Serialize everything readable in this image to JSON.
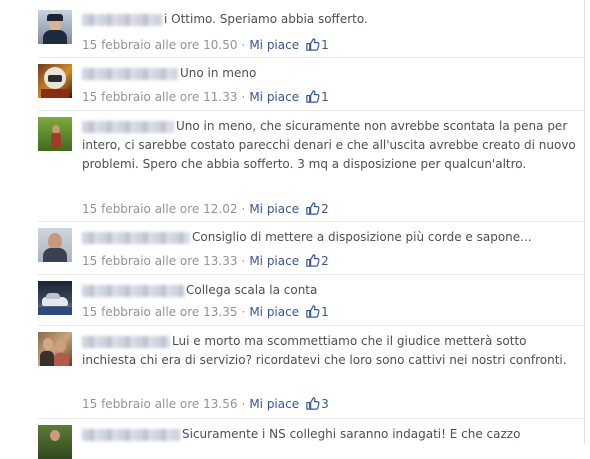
{
  "comments": [
    {
      "text": "i Ottimo. Speriamo abbia sofferto.",
      "time": "15 febbraio alle ore 10.50",
      "like_label": "Mi piace",
      "likes": "1",
      "avatar": "police-officer-avatar"
    },
    {
      "text": "Uno in meno",
      "time": "15 febbraio alle ore 11.33",
      "like_label": "Mi piace",
      "likes": "1",
      "avatar": "helmet-avatar"
    },
    {
      "text": "Uno in meno, che sicuramente non avrebbe scontata la pena per intero, ci sarebbe costato parecchi denari e che all'uscita avrebbe creato di nuovo problemi. Spero che abbia sofferto. 3 mq a disposizione per qualcun'altro.",
      "time": "15 febbraio alle ore 12.02",
      "like_label": "Mi piace",
      "likes": "2",
      "avatar": "garden-person-avatar"
    },
    {
      "text": "Consiglio di mettere a disposizione più corde e sapone...",
      "time": "15 febbraio alle ore 13.33",
      "like_label": "Mi piace",
      "likes": "2",
      "avatar": "man-portrait-avatar"
    },
    {
      "text": "Collega scala la conta",
      "time": "15 febbraio alle ore 13.35",
      "like_label": "Mi piace",
      "likes": "1",
      "avatar": "car-avatar"
    },
    {
      "text": "Lui e morto ma scommettiamo che il giudice metterà sotto inchiesta chi era di servizio? ricordatevi che loro sono cattivi nei nostri confronti.",
      "time": "15 febbraio alle ore 13.56",
      "like_label": "Mi piace",
      "likes": "3",
      "avatar": "couple-avatar"
    },
    {
      "text": "Sicuramente i NS colleghi saranno indagati! E che cazzo",
      "avatar": "outdoor-person-avatar"
    }
  ],
  "colors": {
    "link": "#365899",
    "meta": "#90949c",
    "text": "#4b4f56"
  },
  "meta_separator": "·"
}
